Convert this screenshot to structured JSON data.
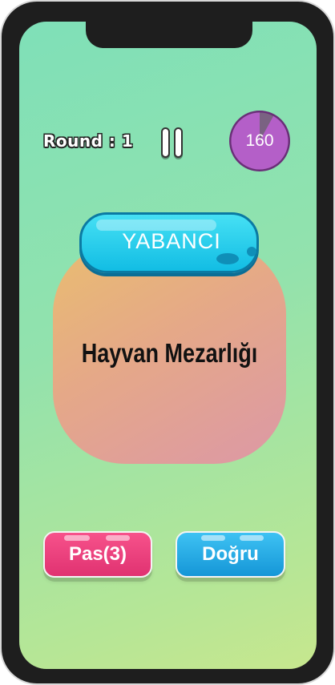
{
  "header": {
    "round_label": "Round : 1",
    "timer_value": "160",
    "timer_remaining_fraction": 0.92
  },
  "team": {
    "label": "YABANCI"
  },
  "card": {
    "word": "Hayvan Mezarlığı"
  },
  "buttons": {
    "pass_label": "Pas(3)",
    "correct_label": "Doğru"
  },
  "colors": {
    "timer_fill": "#b45fc8",
    "timer_elapsed": "#7a6282",
    "pass": "#ef3f7f",
    "correct": "#27abe6",
    "team_badge": "#1cc8ea"
  },
  "icons": {
    "pause": "pause-icon"
  }
}
